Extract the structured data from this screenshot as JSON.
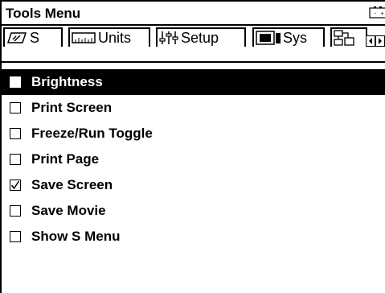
{
  "window": {
    "title": "Tools Menu",
    "status_icon": "battery-icon"
  },
  "tabs": [
    {
      "label": "S",
      "icon": "pencil-icon"
    },
    {
      "label": "Units",
      "icon": "ruler-icon"
    },
    {
      "label": "Setup",
      "icon": "sliders-icon"
    },
    {
      "label": "Sys",
      "icon": "monitor-icon"
    },
    {
      "label": "",
      "icon": "network-icon"
    }
  ],
  "nav": {
    "left_icon": "arrow-left-icon",
    "right_icon": "arrow-right-icon"
  },
  "menu": {
    "items": [
      {
        "label": "Brightness",
        "checked": false,
        "selected": true
      },
      {
        "label": "Print Screen",
        "checked": false,
        "selected": false
      },
      {
        "label": "Freeze/Run Toggle",
        "checked": false,
        "selected": false
      },
      {
        "label": "Print Page",
        "checked": false,
        "selected": false
      },
      {
        "label": "Save Screen",
        "checked": true,
        "selected": false
      },
      {
        "label": "Save Movie",
        "checked": false,
        "selected": false
      },
      {
        "label": "Show S Menu",
        "checked": false,
        "selected": false
      }
    ]
  }
}
